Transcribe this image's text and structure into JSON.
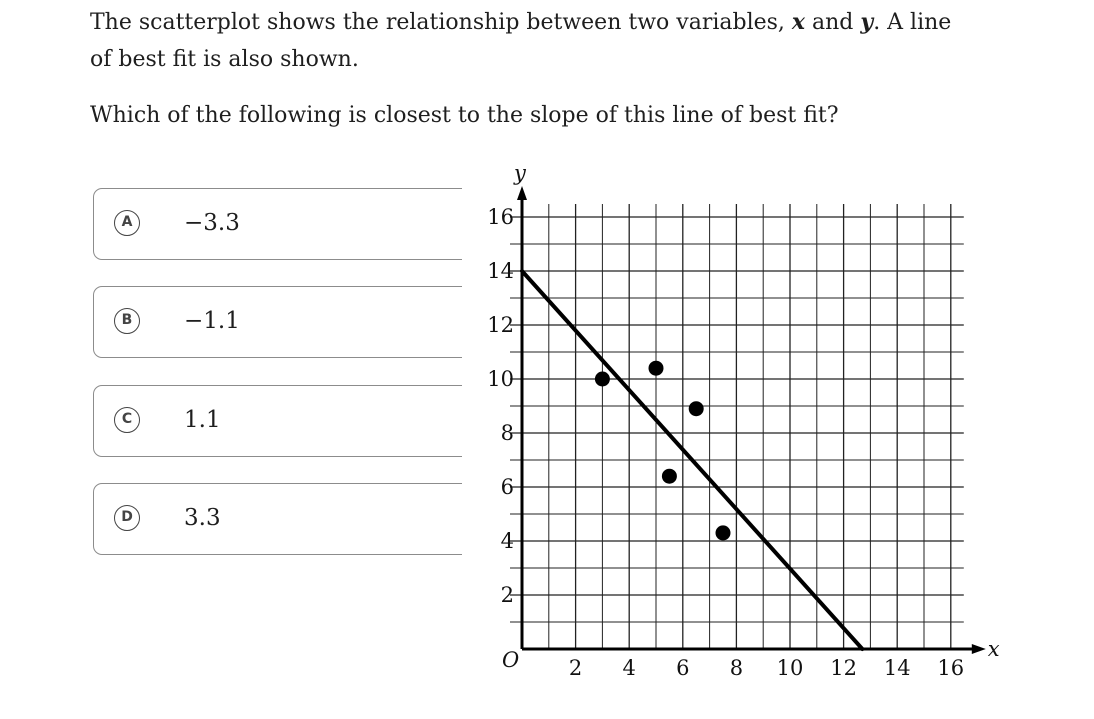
{
  "question": {
    "line1_a": "The scatterplot shows the relationship between two variables, ",
    "var_x": "x",
    "line1_and": " and ",
    "var_y": "y",
    "line1_b": ". A line",
    "line2": "of best fit is also shown.",
    "prompt": "Which of the following is closest to the slope of this line of best fit?"
  },
  "choices": [
    {
      "letter": "A",
      "value": "−3.3"
    },
    {
      "letter": "B",
      "value": "−1.1"
    },
    {
      "letter": "C",
      "value": "1.1"
    },
    {
      "letter": "D",
      "value": "3.3"
    }
  ],
  "chart_data": {
    "type": "scatter",
    "xlabel": "x",
    "ylabel": "y",
    "origin_label": "O",
    "xlim": [
      0,
      16
    ],
    "ylim": [
      0,
      16
    ],
    "xticks": [
      2,
      4,
      6,
      8,
      10,
      12,
      14,
      16
    ],
    "yticks": [
      2,
      4,
      6,
      8,
      10,
      12,
      14,
      16
    ],
    "grid": true,
    "points": [
      {
        "x": 3,
        "y": 10
      },
      {
        "x": 5,
        "y": 10.4
      },
      {
        "x": 6.5,
        "y": 8.9
      },
      {
        "x": 5.5,
        "y": 6.4
      },
      {
        "x": 7.5,
        "y": 4.3
      }
    ],
    "best_fit_line": {
      "x": [
        0,
        12.7
      ],
      "y": [
        14,
        0
      ]
    }
  }
}
